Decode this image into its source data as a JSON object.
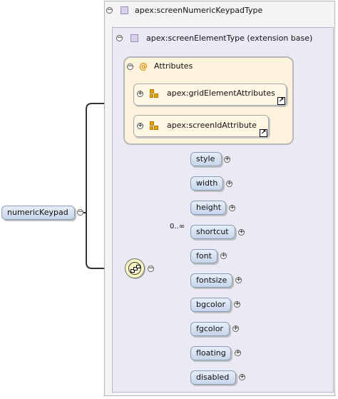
{
  "root_element": {
    "label": "numericKeypad"
  },
  "complex_type": {
    "label": "apex:screenNumericKeypadType"
  },
  "extension": {
    "label": "apex:screenElementType (extension base)"
  },
  "attributes": {
    "group_label": "Attributes",
    "items": [
      {
        "label": "apex:gridElementAttributes"
      },
      {
        "label": "apex:screenIdAttribute"
      }
    ]
  },
  "compositor": {
    "type": "sequence"
  },
  "elements": [
    {
      "label": "style"
    },
    {
      "label": "width"
    },
    {
      "label": "height"
    },
    {
      "label": "shortcut",
      "occurrence": "0..∞"
    },
    {
      "label": "font"
    },
    {
      "label": "fontsize"
    },
    {
      "label": "bgcolor"
    },
    {
      "label": "fgcolor"
    },
    {
      "label": "floating"
    },
    {
      "label": "disabled"
    }
  ],
  "glyphs": {
    "collapse": "−",
    "expand": "+",
    "attribute_group": "@",
    "link": "↗"
  }
}
